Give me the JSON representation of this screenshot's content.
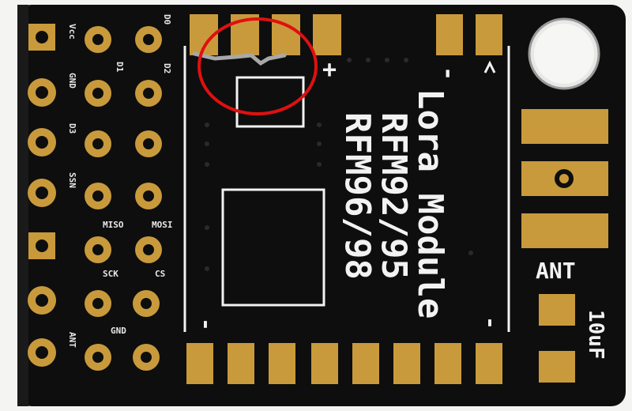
{
  "board": {
    "module_lines": [
      "Lora Module",
      "RFM92/95",
      "RFM96/98"
    ],
    "ant_label": "ANT",
    "cap_label": "10uF",
    "plus_label": "+",
    "minus_label": "-",
    "pin_labels": [
      "Vcc",
      "D0",
      "GND",
      "D1",
      "D2",
      "D3",
      "SCK",
      "MISO",
      "MOSI",
      "CS",
      "SSN",
      "GND",
      "ANT"
    ]
  },
  "colors": {
    "background": "#f4f4f2",
    "pcb": "#0e0e0e",
    "gold": "#c99a3b",
    "silkscreen": "#f2f2f2",
    "highlight_circle": "#e01010"
  }
}
